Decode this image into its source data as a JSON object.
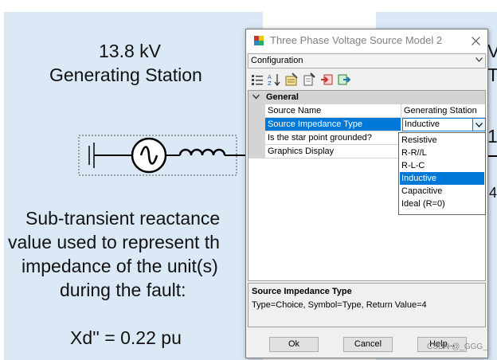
{
  "canvas": {
    "station_voltage": "13.8 kV",
    "station_name": "Generating Station",
    "reactance_lines": [
      "Sub-transient reactance",
      "value used to represent th",
      "impedance of the unit(s)",
      "during the fault:"
    ],
    "reactance_value": "Xd'' = 0.22 pu",
    "right_peek": [
      "V",
      "T",
      "1",
      "4"
    ]
  },
  "dialog": {
    "title": "Three Phase Voltage Source Model 2",
    "config_selected": "Configuration",
    "toolbar_icons": [
      "categorized-icon",
      "sort-alpha-icon",
      "properties-icon",
      "copy-icon",
      "import-icon",
      "export-icon"
    ],
    "category": "General",
    "properties": [
      {
        "name": "Source Name",
        "value": "Generating Station"
      },
      {
        "name": "Source Impedance Type",
        "value": "Inductive"
      },
      {
        "name": "Is the star point grounded?",
        "value": ""
      },
      {
        "name": "Graphics Display",
        "value": ""
      }
    ],
    "dropdown_options": [
      "Resistive",
      "R-R//L",
      "R-L-C",
      "Inductive",
      "Capacitive",
      "Ideal (R=0)"
    ],
    "dropdown_selected": "Inductive",
    "description": {
      "title": "Source Impedance Type",
      "body": "Type=Choice, Symbol=Type, Return Value=4"
    },
    "buttons": {
      "ok": "Ok",
      "cancel": "Cancel",
      "help": "Help..."
    }
  },
  "watermark": "CSDN @_GGG_",
  "colors": {
    "selection": "#0078d7",
    "canvas_bg": "#dbe9f7",
    "dialog_bg": "#f0f0f0"
  }
}
